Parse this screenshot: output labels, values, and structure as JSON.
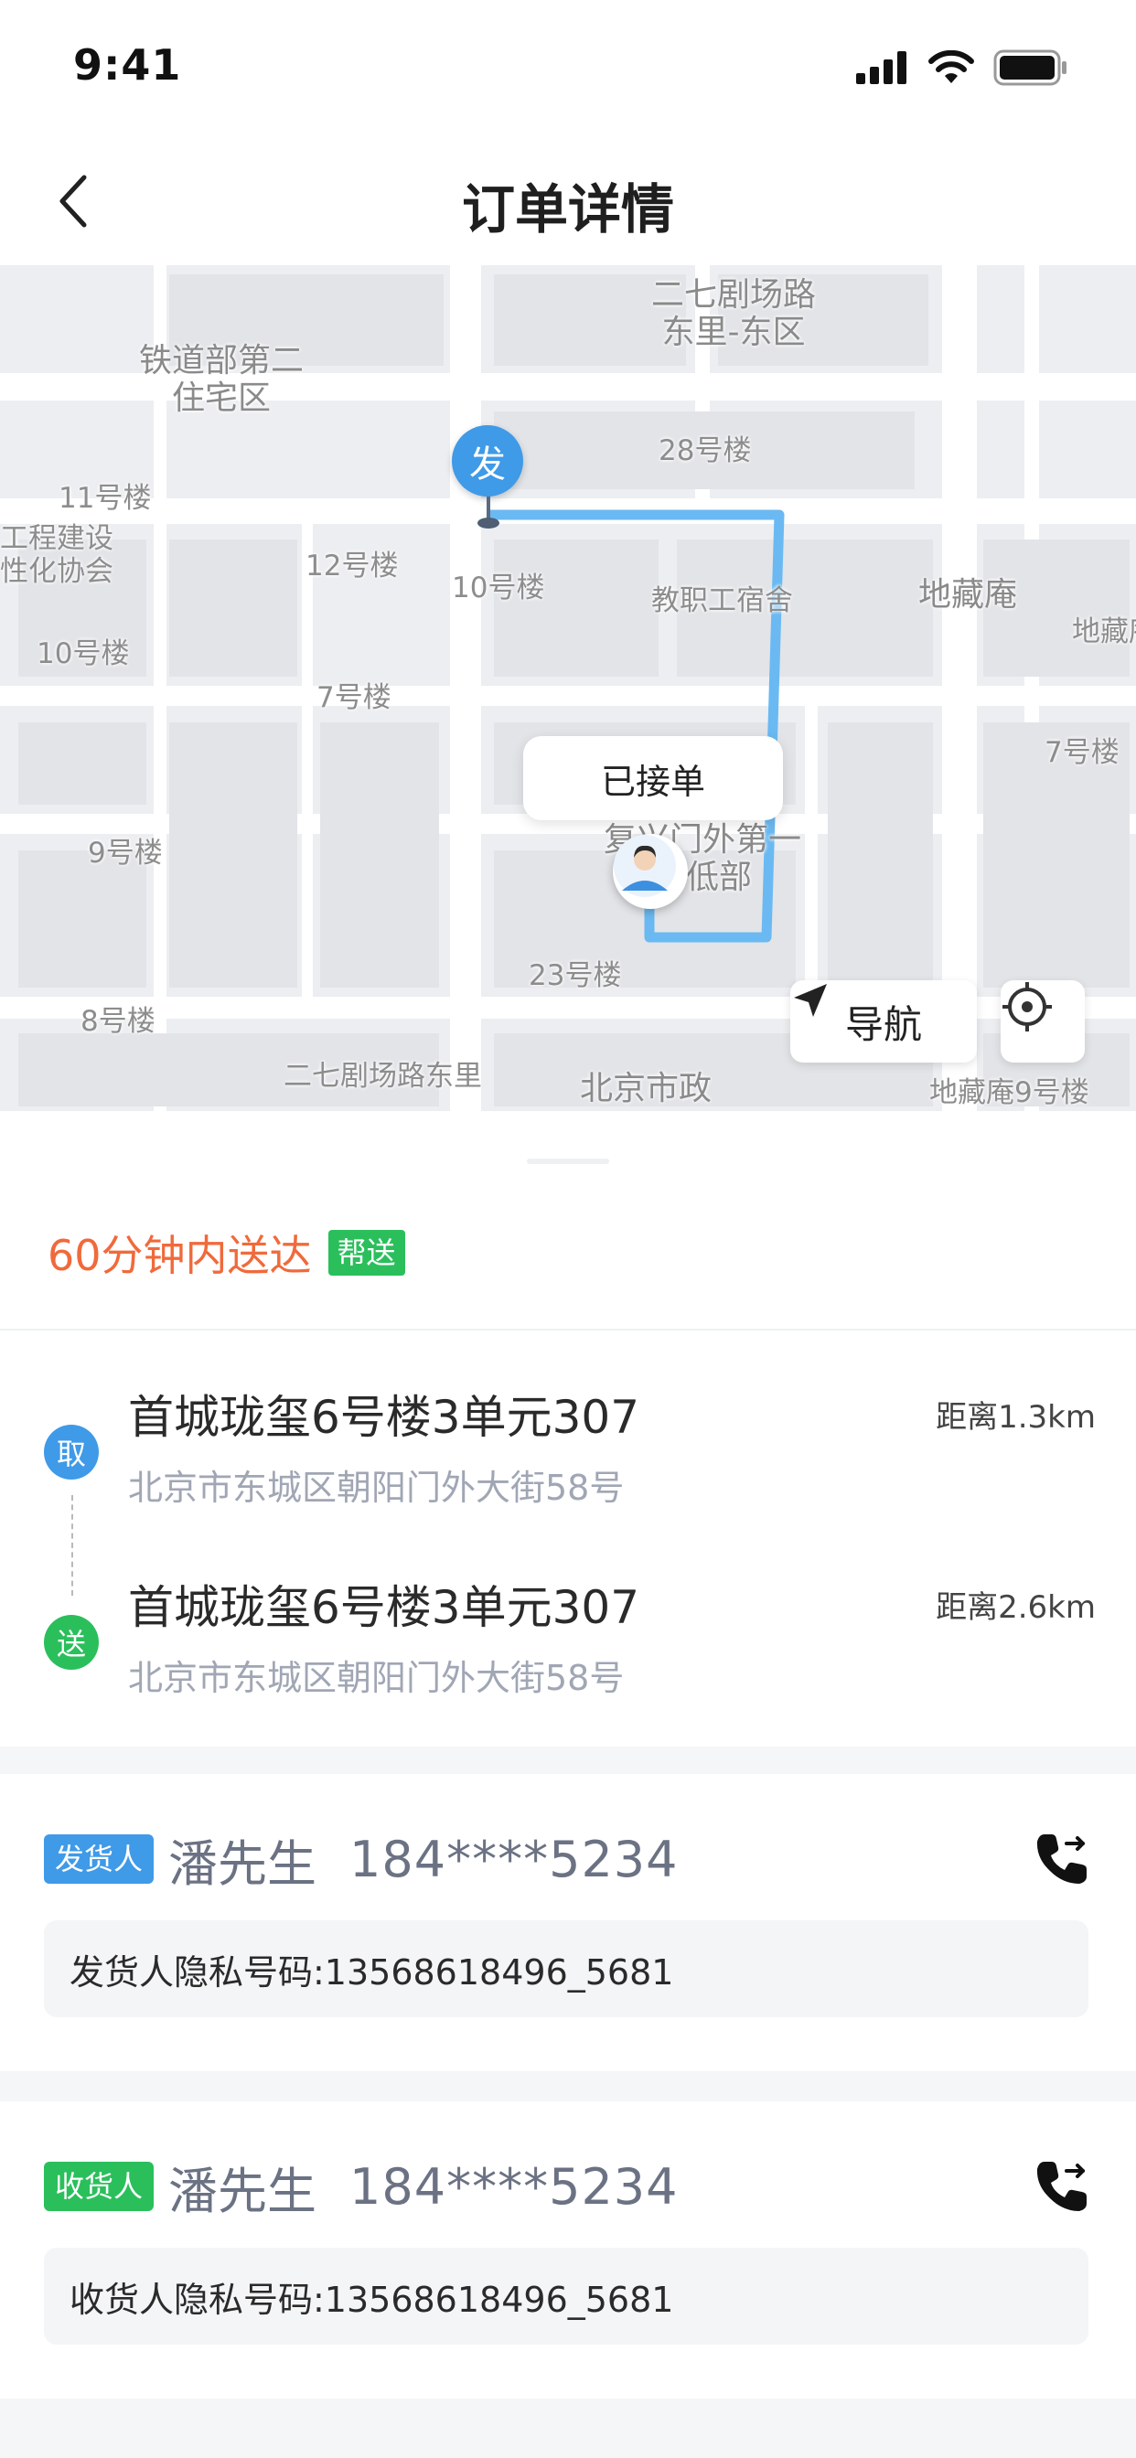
{
  "status_bar": {
    "time": "9:41"
  },
  "nav": {
    "title": "订单详情"
  },
  "map": {
    "labels": [
      "二七剧场路\n东里-东区",
      "铁道部第二\n住宅区",
      "28号楼",
      "11号楼",
      "工程建设\n性化协会",
      "12号楼",
      "10号楼",
      "教职工宿舍",
      "地藏庵",
      "地藏庵",
      "10号楼",
      "7号楼",
      "7号楼",
      "复兴门外第一\n学低部",
      "9号楼",
      "23号楼",
      "8号楼",
      "二七剧场路东里",
      "北京市政",
      "地藏庵9号楼"
    ],
    "send_pin": "发",
    "status_bubble": "已接单",
    "navigate_label": "导航"
  },
  "order": {
    "eta": "60分钟内送达",
    "service_tag": "帮送",
    "pickup": {
      "icon": "取",
      "title": "首城珑玺6号楼3单元307",
      "address": "北京市东城区朝阳门外大街58号",
      "distance": "距离1.3km"
    },
    "delivery": {
      "icon": "送",
      "title": "首城珑玺6号楼3单元307",
      "address": "北京市东城区朝阳门外大街58号",
      "distance": "距离2.6km"
    }
  },
  "sender": {
    "role": "发货人",
    "name": "潘先生",
    "phone": "184****5234",
    "private_number": "发货人隐私号码:13568618496_5681"
  },
  "receiver": {
    "role": "收货人",
    "name": "潘先生",
    "phone": "184****5234",
    "private_number": "收货人隐私号码:13568618496_5681"
  },
  "colors": {
    "accent_orange": "#f06a3b",
    "green": "#2bbf5c",
    "blue": "#3f9ae8",
    "route": "#6ab9f2"
  }
}
